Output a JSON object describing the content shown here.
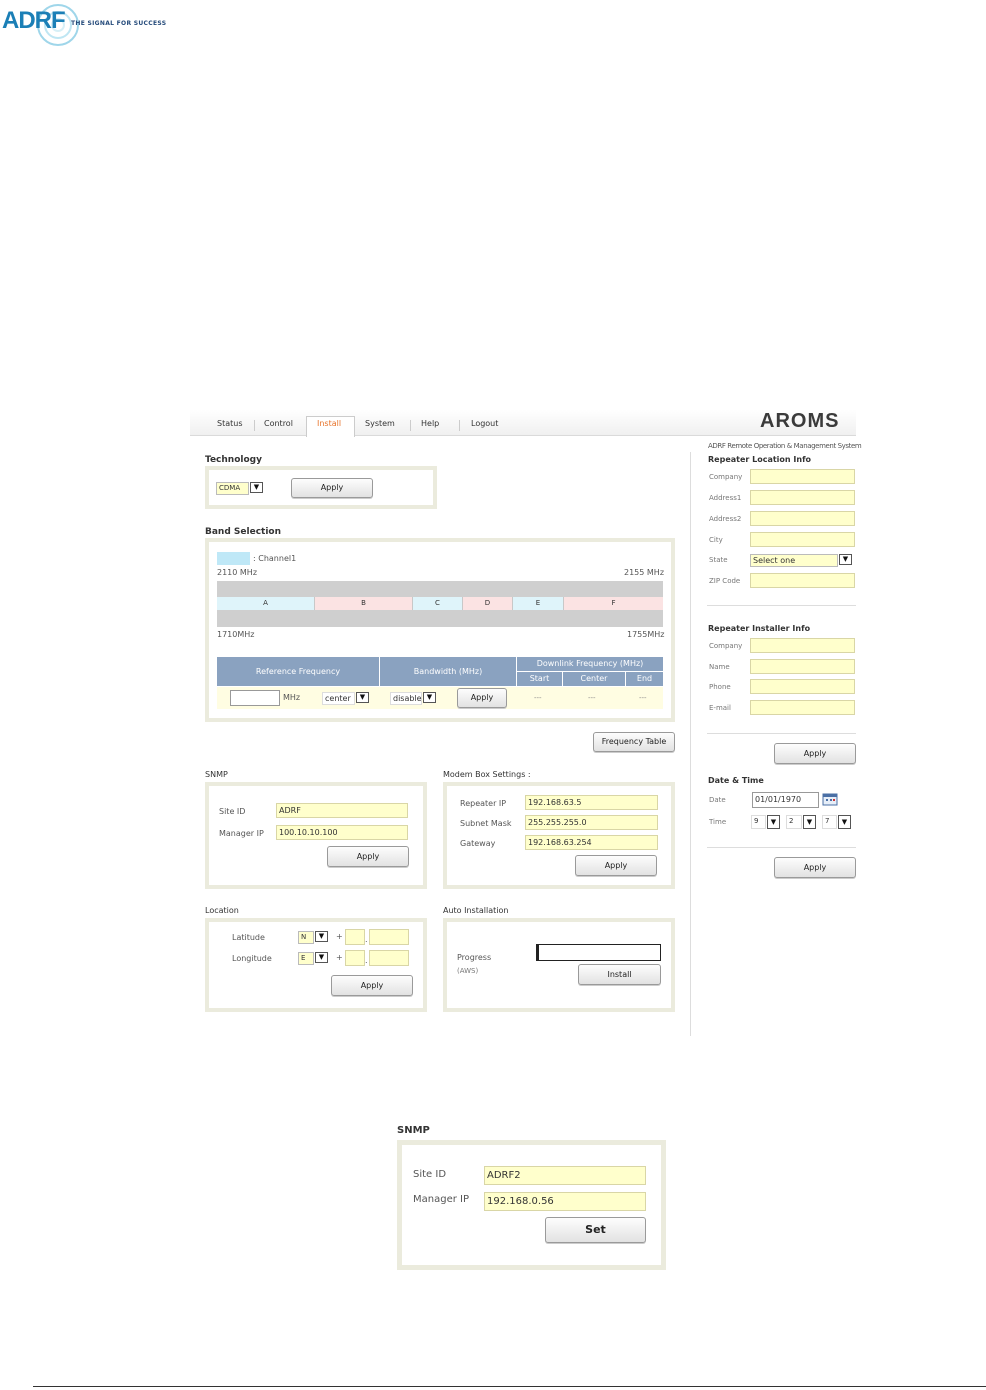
{
  "brand": {
    "logo_text": "ADRF",
    "tagline": "THE SIGNAL FOR SUCCESS"
  },
  "app": {
    "title": "AROMS",
    "subtitle": "ADRF Remote Operation & Management System"
  },
  "nav": {
    "tabs": [
      {
        "label": "Status",
        "active": false
      },
      {
        "label": "Control",
        "active": false
      },
      {
        "label": "Install",
        "active": true
      },
      {
        "label": "System",
        "active": false
      },
      {
        "label": "Help",
        "active": false
      },
      {
        "label": "Logout",
        "active": false
      }
    ]
  },
  "technology": {
    "title": "Technology",
    "value": "CDMA",
    "apply": "Apply"
  },
  "band": {
    "title": "Band Selection",
    "legend": ": Channel1",
    "dl_start": "2110 MHz",
    "dl_end": "2155 MHz",
    "ul_start": "1710MHz",
    "ul_end": "1755MHz",
    "blocks": [
      "A",
      "B",
      "C",
      "D",
      "E",
      "F"
    ],
    "table": {
      "h_ref": "Reference Frequency",
      "h_bw": "Bandwidth (MHz)",
      "h_dl": "Downlink Frequency (MHz)",
      "h_start": "Start",
      "h_center": "Center",
      "h_end": "End",
      "unit": "MHz",
      "ref_mode": "center",
      "bw": "disable",
      "apply": "Apply",
      "start": "---",
      "center": "---",
      "end": "---"
    },
    "freq_table": "Frequency Table"
  },
  "snmp": {
    "title": "SNMP",
    "site_label": "Site ID",
    "site_value": "ADRF",
    "mgr_label": "Manager IP",
    "mgr_value": "100.10.10.100",
    "apply": "Apply"
  },
  "modem": {
    "title": "Modem Box Settings :",
    "rip_label": "Repeater IP",
    "rip_value": "192.168.63.5",
    "mask_label": "Subnet Mask",
    "mask_value": "255.255.255.0",
    "gw_label": "Gateway",
    "gw_value": "192.168.63.254",
    "apply": "Apply"
  },
  "location": {
    "title": "Location",
    "lat_label": "Latitude",
    "lat_dir": "N",
    "lon_label": "Longitude",
    "lon_dir": "E",
    "plus": "+",
    "dot": ".",
    "apply": "Apply"
  },
  "auto": {
    "title": "Auto Installation",
    "progress_label": "Progress",
    "progress_sub": "(AWS)",
    "progress": 0,
    "install": "Install"
  },
  "right": {
    "loc_title": "Repeater Location Info",
    "company": "Company",
    "addr1": "Address1",
    "addr2": "Address2",
    "city": "City",
    "state": "State",
    "state_value": "Select one",
    "zip": "ZIP Code",
    "inst_title": "Repeater Installer Info",
    "i_company": "Company",
    "i_name": "Name",
    "i_phone": "Phone",
    "i_email": "E-mail",
    "apply": "Apply",
    "dt_title": "Date & Time",
    "date_label": "Date",
    "date_value": "01/01/1970",
    "time_label": "Time",
    "hour": "9",
    "minute": "2",
    "second": "7",
    "apply2": "Apply"
  },
  "snmp2": {
    "title": "SNMP",
    "site_label": "Site ID",
    "site_value": "ADRF2",
    "mgr_label": "Manager IP",
    "mgr_value": "192.168.0.56",
    "set": "Set"
  },
  "colors": {
    "accent": "#e8742a",
    "header": "#8aa2c0",
    "field": "#ffffcc",
    "channel": "#bfe8f7"
  }
}
